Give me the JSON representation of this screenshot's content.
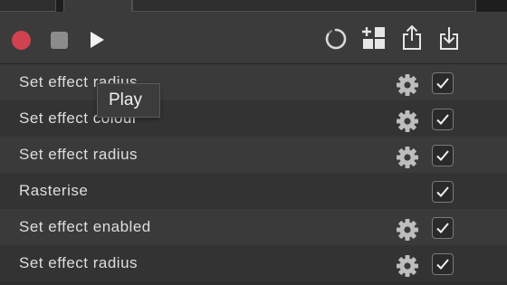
{
  "toolbar": {
    "record_icon": "record-icon",
    "stop_icon": "stop-icon",
    "play_icon": "play-icon",
    "loading_icon": "loading-spinner-icon",
    "add_icon": "add-new-icon",
    "export_icon": "export-icon",
    "import_icon": "import-icon",
    "record_color": "#d0424f"
  },
  "tooltip": {
    "text": "Play"
  },
  "list": {
    "items": [
      {
        "label": "Set effect radius",
        "has_settings": true,
        "checked": true
      },
      {
        "label": "Set effect colour",
        "has_settings": true,
        "checked": true
      },
      {
        "label": "Set effect radius",
        "has_settings": true,
        "checked": true
      },
      {
        "label": "Rasterise",
        "has_settings": false,
        "checked": true
      },
      {
        "label": "Set effect enabled",
        "has_settings": true,
        "checked": true
      },
      {
        "label": "Set effect radius",
        "has_settings": true,
        "checked": true
      }
    ]
  }
}
